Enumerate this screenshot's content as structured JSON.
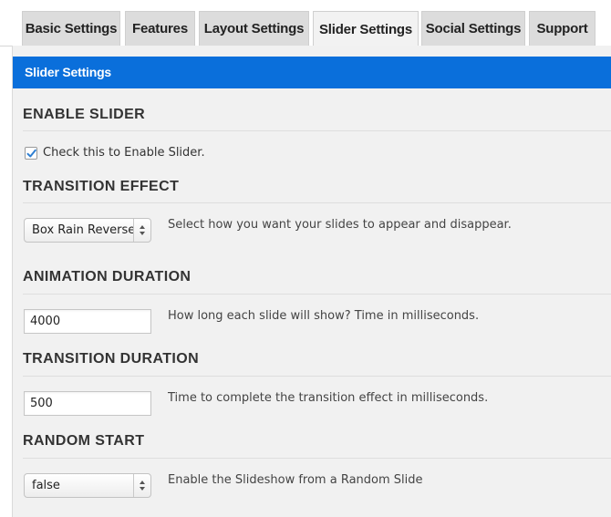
{
  "tabs": [
    {
      "label": "Basic Settings",
      "active": false
    },
    {
      "label": "Features",
      "active": false
    },
    {
      "label": "Layout Settings",
      "active": false
    },
    {
      "label": "Slider Settings",
      "active": true
    },
    {
      "label": "Social Settings",
      "active": false
    },
    {
      "label": "Support",
      "active": false
    }
  ],
  "panel": {
    "title": "Slider Settings"
  },
  "colors": {
    "header_blue": "#0a6fdb",
    "panel_bg": "#f1f1f1",
    "checkmark": "#2f7fd1"
  },
  "sections": {
    "enable_slider": {
      "title": "ENABLE SLIDER",
      "checkbox_label": "Check this to Enable Slider.",
      "checked": true
    },
    "transition_effect": {
      "title": "TRANSITION EFFECT",
      "value": "Box Rain Reverse",
      "description": "Select how you want your slides to appear and disappear."
    },
    "animation_duration": {
      "title": "ANIMATION DURATION",
      "value": "4000",
      "description": "How long each slide will show? Time in milliseconds."
    },
    "transition_duration": {
      "title": "TRANSITION DURATION",
      "value": "500",
      "description": "Time to complete the transition effect in milliseconds."
    },
    "random_start": {
      "title": "RANDOM START",
      "value": "false",
      "description": "Enable the Slideshow from a Random Slide"
    }
  }
}
